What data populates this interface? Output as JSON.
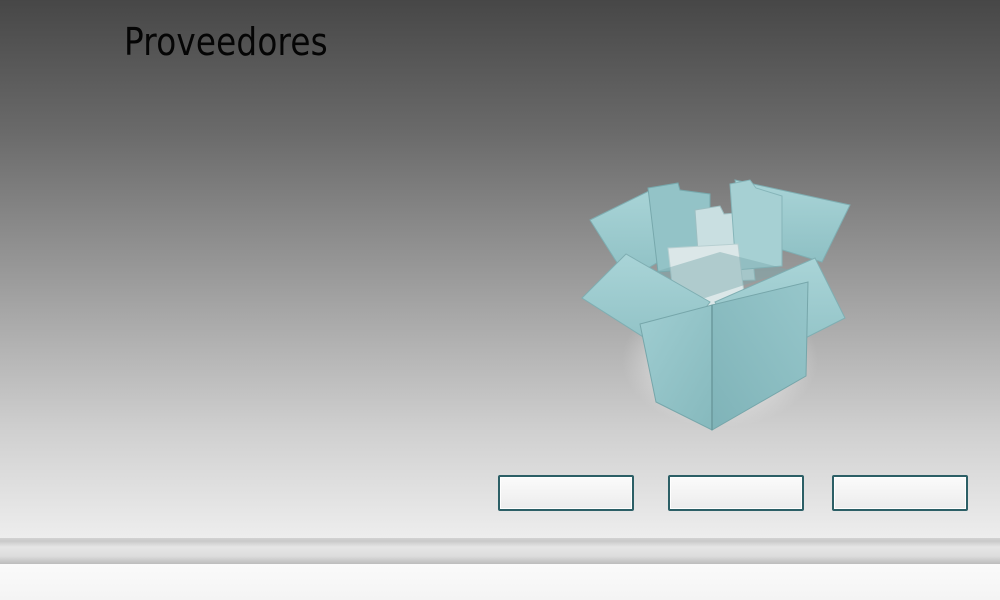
{
  "page": {
    "title": "Proveedores"
  },
  "illustration": {
    "icon": "open-box-with-folders",
    "color": "#8fc2c6"
  },
  "actions": [
    {
      "label": ""
    },
    {
      "label": ""
    },
    {
      "label": ""
    }
  ],
  "theme": {
    "accent": "#2c5f66",
    "background_top": "#474747",
    "background_bottom": "#efefef"
  }
}
